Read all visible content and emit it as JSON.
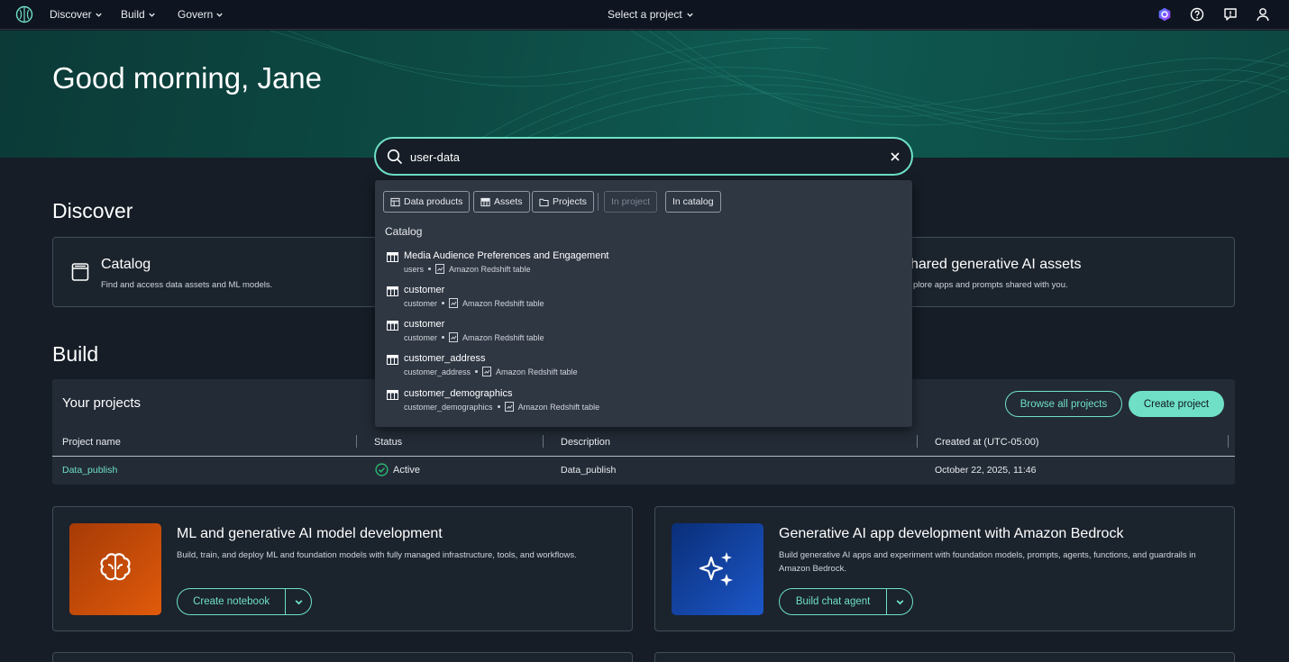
{
  "nav": {
    "menus": [
      "Discover",
      "Build",
      "Govern"
    ],
    "project_select": "Select a project"
  },
  "hero": {
    "greeting": "Good morning, Jane"
  },
  "search": {
    "value": "user-data",
    "placeholder": "Search"
  },
  "dropdown": {
    "chips": [
      {
        "label": "Data products",
        "icon": "data-product-icon"
      },
      {
        "label": "Assets",
        "icon": "table-icon"
      },
      {
        "label": "Projects",
        "icon": "folder-icon"
      },
      {
        "label": "In project",
        "disabled": true
      },
      {
        "label": "In catalog"
      }
    ],
    "section": "Catalog",
    "results": [
      {
        "name": "Media Audience Preferences and Engagement",
        "sub": "users",
        "type": "Amazon Redshift table"
      },
      {
        "name": "customer",
        "sub": "customer",
        "type": "Amazon Redshift table"
      },
      {
        "name": "customer",
        "sub": "customer",
        "type": "Amazon Redshift table"
      },
      {
        "name": "customer_address",
        "sub": "customer_address",
        "type": "Amazon Redshift table"
      },
      {
        "name": "customer_demographics",
        "sub": "customer_demographics",
        "type": "Amazon Redshift table"
      }
    ]
  },
  "discover": {
    "title": "Discover",
    "catalog": {
      "title": "Catalog",
      "desc": "Find and access data assets and ML models."
    },
    "shared": {
      "title": "hared generative AI assets",
      "desc": "plore apps and prompts shared with you."
    }
  },
  "build": {
    "title": "Build",
    "projects": {
      "title": "Your projects",
      "browse_label": "Browse all projects",
      "create_label": "Create project",
      "columns": [
        "Project name",
        "Status",
        "Description",
        "Created at (UTC-05:00)"
      ],
      "rows": [
        {
          "name": "Data_publish",
          "status": "Active",
          "description": "Data_publish",
          "created": "October 22, 2025, 11:46"
        }
      ]
    },
    "ml_card": {
      "title": "ML and generative AI model development",
      "desc": "Build, train, and deploy ML and foundation models with fully managed infrastructure, tools, and workflows.",
      "button": "Create notebook"
    },
    "bedrock_card": {
      "title": "Generative AI app development with Amazon Bedrock",
      "desc_line1": "Build generative AI apps and experiment with foundation models, prompts, agents, functions, and guardrails in",
      "desc_line2": "Amazon Bedrock.",
      "button": "Build chat agent"
    }
  },
  "colors": {
    "accent": "#6fe0c6",
    "background": "#161d26",
    "status_active": "#2bb673"
  }
}
